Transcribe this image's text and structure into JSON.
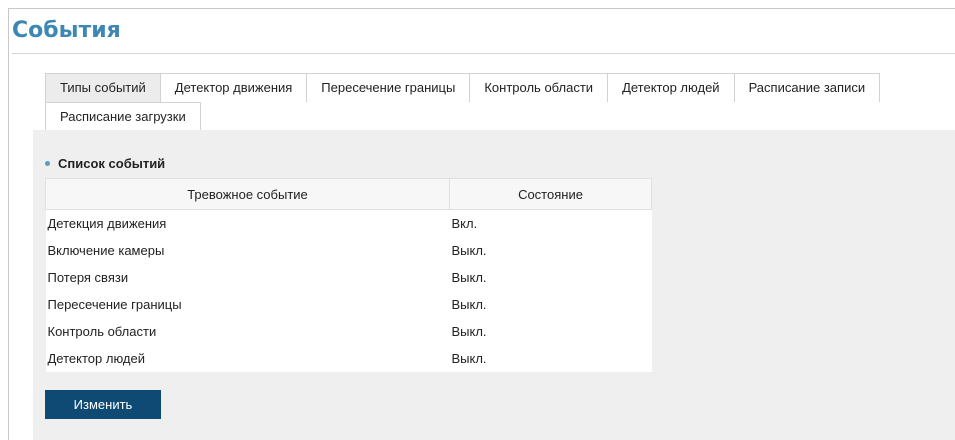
{
  "page": {
    "title": "События"
  },
  "tabs": {
    "row1": [
      {
        "label": "Типы событий",
        "active": true
      },
      {
        "label": "Детектор движения",
        "active": false
      },
      {
        "label": "Пересечение границы",
        "active": false
      },
      {
        "label": "Контроль области",
        "active": false
      },
      {
        "label": "Детектор людей",
        "active": false
      },
      {
        "label": "Расписание записи",
        "active": false
      }
    ],
    "row2": [
      {
        "label": "Расписание загрузки",
        "active": false
      }
    ]
  },
  "events": {
    "section_title": "Список событий",
    "columns": [
      "Тревожное событие",
      "Состояние"
    ],
    "rows": [
      {
        "event": "Детекция движения",
        "state": "Вкл."
      },
      {
        "event": "Включение камеры",
        "state": "Выкл."
      },
      {
        "event": "Потеря связи",
        "state": "Выкл."
      },
      {
        "event": "Пересечение границы",
        "state": "Выкл."
      },
      {
        "event": "Контроль области",
        "state": "Выкл."
      },
      {
        "event": "Детектор людей",
        "state": "Выкл."
      }
    ]
  },
  "actions": {
    "edit_label": "Изменить"
  },
  "colors": {
    "title": "#3d87b5",
    "button": "#0e4a73",
    "panel": "#efefef",
    "bullet": "#5a9bc8"
  }
}
